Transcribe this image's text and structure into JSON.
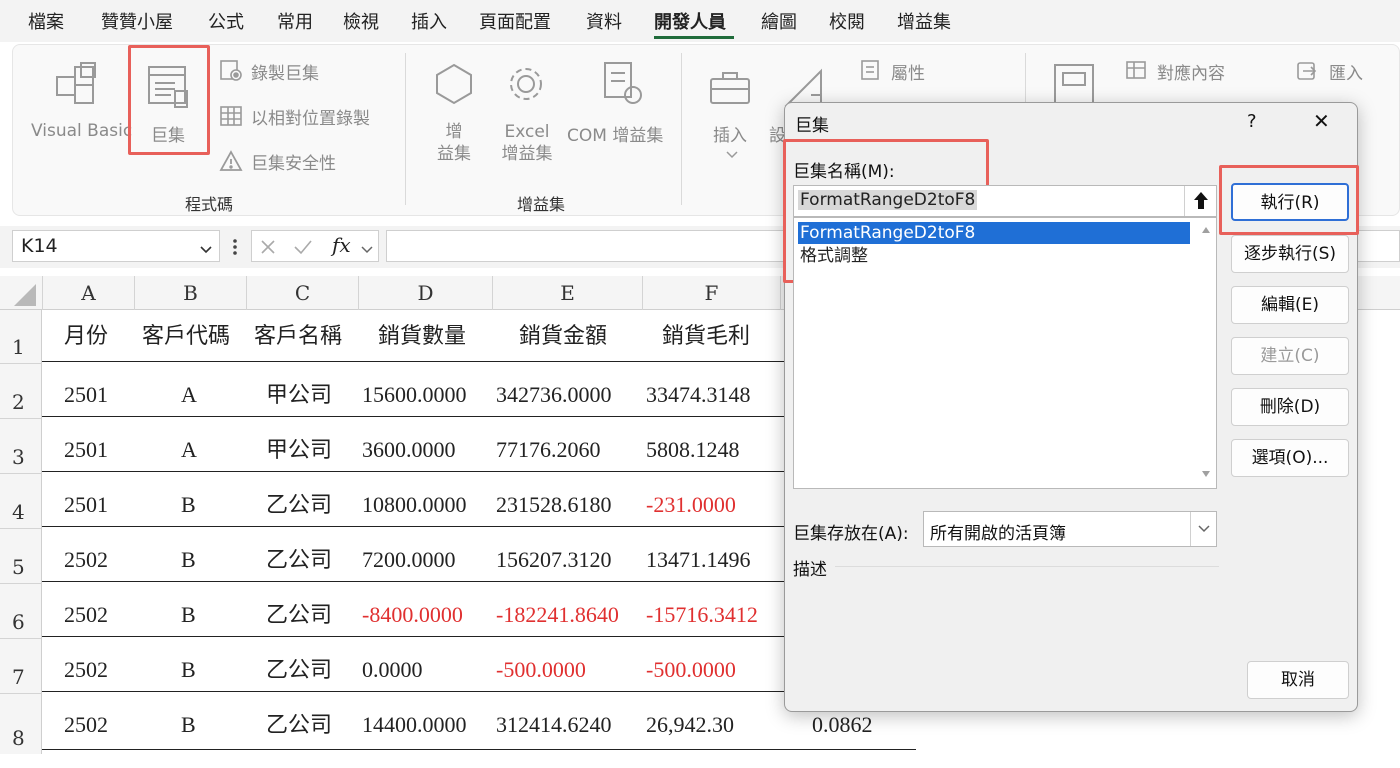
{
  "menu": {
    "tabs": [
      "檔案",
      "贊贊小屋",
      "公式",
      "常用",
      "檢視",
      "插入",
      "頁面配置",
      "資料",
      "開發人員",
      "繪圖",
      "校閱",
      "增益集"
    ],
    "active_tab": "開發人員"
  },
  "ribbon": {
    "visual_basic": "Visual Basic",
    "macros": "巨集",
    "record_macro": "錄製巨集",
    "relative_ref": "以相對位置錄製",
    "macro_security": "巨集安全性",
    "group_code": "程式碼",
    "addins_line1": "增",
    "addins_line2": "益集",
    "excel_addins_line1": "Excel",
    "excel_addins_line2": "增益集",
    "com_addins": "COM 增益集",
    "group_addins": "增益集",
    "insert": "插入",
    "design_partial": "設",
    "properties": "屬性",
    "map_properties": "對應內容",
    "import": "匯入"
  },
  "formula_bar": {
    "name_box": "K14",
    "fx": "fx",
    "formula": ""
  },
  "grid": {
    "columns": [
      "A",
      "B",
      "C",
      "D",
      "E",
      "F"
    ],
    "row_numbers": [
      "1",
      "2",
      "3",
      "4",
      "5",
      "6",
      "7",
      "8"
    ],
    "header_row": [
      "月份",
      "客戶代碼",
      "客戶名稱",
      "銷貨數量",
      "銷貨金額",
      "銷貨毛利"
    ],
    "rows": [
      [
        "2501",
        "A",
        "甲公司",
        "15600.0000",
        "342736.0000",
        "33474.3148",
        ""
      ],
      [
        "2501",
        "A",
        "甲公司",
        "3600.0000",
        "77176.2060",
        "5808.1248",
        ""
      ],
      [
        "2501",
        "B",
        "乙公司",
        "10800.0000",
        "231528.6180",
        "-231.0000",
        ""
      ],
      [
        "2502",
        "B",
        "乙公司",
        "7200.0000",
        "156207.3120",
        "13471.1496",
        ""
      ],
      [
        "2502",
        "B",
        "乙公司",
        "-8400.0000",
        "-182241.8640",
        "-15716.3412",
        ""
      ],
      [
        "2502",
        "B",
        "乙公司",
        "0.0000",
        "-500.0000",
        "-500.0000",
        ""
      ],
      [
        "2502",
        "B",
        "乙公司",
        "14400.0000",
        "312414.6240",
        "26,942.30",
        "0.0862"
      ]
    ],
    "negative_color": "#e03030"
  },
  "dialog": {
    "title": "巨集",
    "help": "?",
    "close": "✕",
    "name_label": "巨集名稱(M):",
    "name_value": "FormatRangeD2toF8",
    "list": [
      "FormatRangeD2toF8",
      "格式調整"
    ],
    "selected_index": 0,
    "buttons": {
      "run": "執行(R)",
      "step": "逐步執行(S)",
      "edit": "編輯(E)",
      "create": "建立(C)",
      "delete": "刪除(D)",
      "options": "選項(O)...",
      "cancel": "取消"
    },
    "location_label": "巨集存放在(A):",
    "location_value": "所有開啟的活頁簿",
    "description_label": "描述",
    "accent_color": "#1f6fd6",
    "highlight_color": "#e8605a"
  }
}
